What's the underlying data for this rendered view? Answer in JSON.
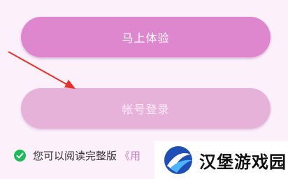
{
  "buttons": {
    "primary_label": "马上体验",
    "secondary_label": "帐号登录"
  },
  "agreement": {
    "text": "您可以阅读完整版",
    "link_text": "《用"
  },
  "watermark": {
    "text": "汉堡游戏园"
  },
  "colors": {
    "background": "#fcf0fb",
    "primary_button": "#de87cf",
    "secondary_button": "#e6b2da",
    "check": "#1fb85a",
    "arrow": "#e8302a",
    "link": "#c77fbf"
  }
}
